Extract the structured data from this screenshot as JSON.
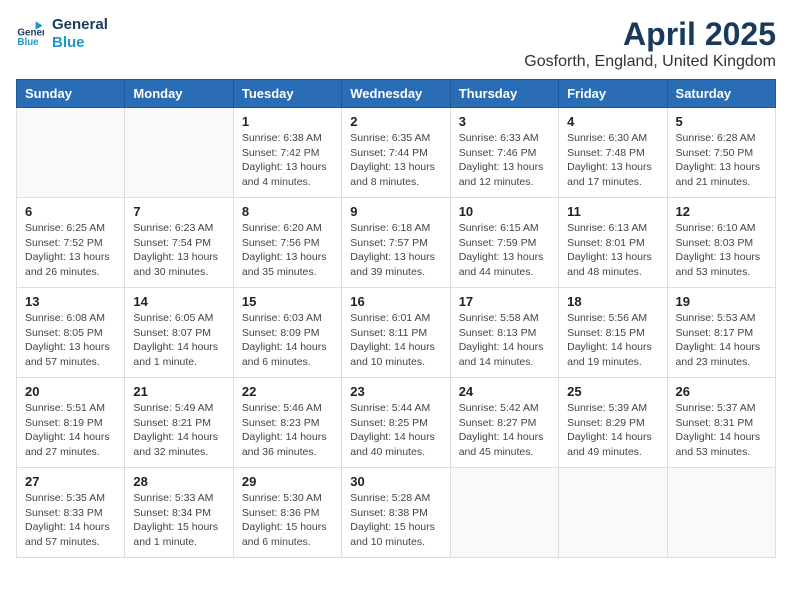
{
  "logo": {
    "line1": "General",
    "line2": "Blue"
  },
  "title": "April 2025",
  "subtitle": "Gosforth, England, United Kingdom",
  "days_of_week": [
    "Sunday",
    "Monday",
    "Tuesday",
    "Wednesday",
    "Thursday",
    "Friday",
    "Saturday"
  ],
  "weeks": [
    [
      {
        "day": "",
        "info": ""
      },
      {
        "day": "",
        "info": ""
      },
      {
        "day": "1",
        "info": "Sunrise: 6:38 AM\nSunset: 7:42 PM\nDaylight: 13 hours\nand 4 minutes."
      },
      {
        "day": "2",
        "info": "Sunrise: 6:35 AM\nSunset: 7:44 PM\nDaylight: 13 hours\nand 8 minutes."
      },
      {
        "day": "3",
        "info": "Sunrise: 6:33 AM\nSunset: 7:46 PM\nDaylight: 13 hours\nand 12 minutes."
      },
      {
        "day": "4",
        "info": "Sunrise: 6:30 AM\nSunset: 7:48 PM\nDaylight: 13 hours\nand 17 minutes."
      },
      {
        "day": "5",
        "info": "Sunrise: 6:28 AM\nSunset: 7:50 PM\nDaylight: 13 hours\nand 21 minutes."
      }
    ],
    [
      {
        "day": "6",
        "info": "Sunrise: 6:25 AM\nSunset: 7:52 PM\nDaylight: 13 hours\nand 26 minutes."
      },
      {
        "day": "7",
        "info": "Sunrise: 6:23 AM\nSunset: 7:54 PM\nDaylight: 13 hours\nand 30 minutes."
      },
      {
        "day": "8",
        "info": "Sunrise: 6:20 AM\nSunset: 7:56 PM\nDaylight: 13 hours\nand 35 minutes."
      },
      {
        "day": "9",
        "info": "Sunrise: 6:18 AM\nSunset: 7:57 PM\nDaylight: 13 hours\nand 39 minutes."
      },
      {
        "day": "10",
        "info": "Sunrise: 6:15 AM\nSunset: 7:59 PM\nDaylight: 13 hours\nand 44 minutes."
      },
      {
        "day": "11",
        "info": "Sunrise: 6:13 AM\nSunset: 8:01 PM\nDaylight: 13 hours\nand 48 minutes."
      },
      {
        "day": "12",
        "info": "Sunrise: 6:10 AM\nSunset: 8:03 PM\nDaylight: 13 hours\nand 53 minutes."
      }
    ],
    [
      {
        "day": "13",
        "info": "Sunrise: 6:08 AM\nSunset: 8:05 PM\nDaylight: 13 hours\nand 57 minutes."
      },
      {
        "day": "14",
        "info": "Sunrise: 6:05 AM\nSunset: 8:07 PM\nDaylight: 14 hours\nand 1 minute."
      },
      {
        "day": "15",
        "info": "Sunrise: 6:03 AM\nSunset: 8:09 PM\nDaylight: 14 hours\nand 6 minutes."
      },
      {
        "day": "16",
        "info": "Sunrise: 6:01 AM\nSunset: 8:11 PM\nDaylight: 14 hours\nand 10 minutes."
      },
      {
        "day": "17",
        "info": "Sunrise: 5:58 AM\nSunset: 8:13 PM\nDaylight: 14 hours\nand 14 minutes."
      },
      {
        "day": "18",
        "info": "Sunrise: 5:56 AM\nSunset: 8:15 PM\nDaylight: 14 hours\nand 19 minutes."
      },
      {
        "day": "19",
        "info": "Sunrise: 5:53 AM\nSunset: 8:17 PM\nDaylight: 14 hours\nand 23 minutes."
      }
    ],
    [
      {
        "day": "20",
        "info": "Sunrise: 5:51 AM\nSunset: 8:19 PM\nDaylight: 14 hours\nand 27 minutes."
      },
      {
        "day": "21",
        "info": "Sunrise: 5:49 AM\nSunset: 8:21 PM\nDaylight: 14 hours\nand 32 minutes."
      },
      {
        "day": "22",
        "info": "Sunrise: 5:46 AM\nSunset: 8:23 PM\nDaylight: 14 hours\nand 36 minutes."
      },
      {
        "day": "23",
        "info": "Sunrise: 5:44 AM\nSunset: 8:25 PM\nDaylight: 14 hours\nand 40 minutes."
      },
      {
        "day": "24",
        "info": "Sunrise: 5:42 AM\nSunset: 8:27 PM\nDaylight: 14 hours\nand 45 minutes."
      },
      {
        "day": "25",
        "info": "Sunrise: 5:39 AM\nSunset: 8:29 PM\nDaylight: 14 hours\nand 49 minutes."
      },
      {
        "day": "26",
        "info": "Sunrise: 5:37 AM\nSunset: 8:31 PM\nDaylight: 14 hours\nand 53 minutes."
      }
    ],
    [
      {
        "day": "27",
        "info": "Sunrise: 5:35 AM\nSunset: 8:33 PM\nDaylight: 14 hours\nand 57 minutes."
      },
      {
        "day": "28",
        "info": "Sunrise: 5:33 AM\nSunset: 8:34 PM\nDaylight: 15 hours\nand 1 minute."
      },
      {
        "day": "29",
        "info": "Sunrise: 5:30 AM\nSunset: 8:36 PM\nDaylight: 15 hours\nand 6 minutes."
      },
      {
        "day": "30",
        "info": "Sunrise: 5:28 AM\nSunset: 8:38 PM\nDaylight: 15 hours\nand 10 minutes."
      },
      {
        "day": "",
        "info": ""
      },
      {
        "day": "",
        "info": ""
      },
      {
        "day": "",
        "info": ""
      }
    ]
  ]
}
